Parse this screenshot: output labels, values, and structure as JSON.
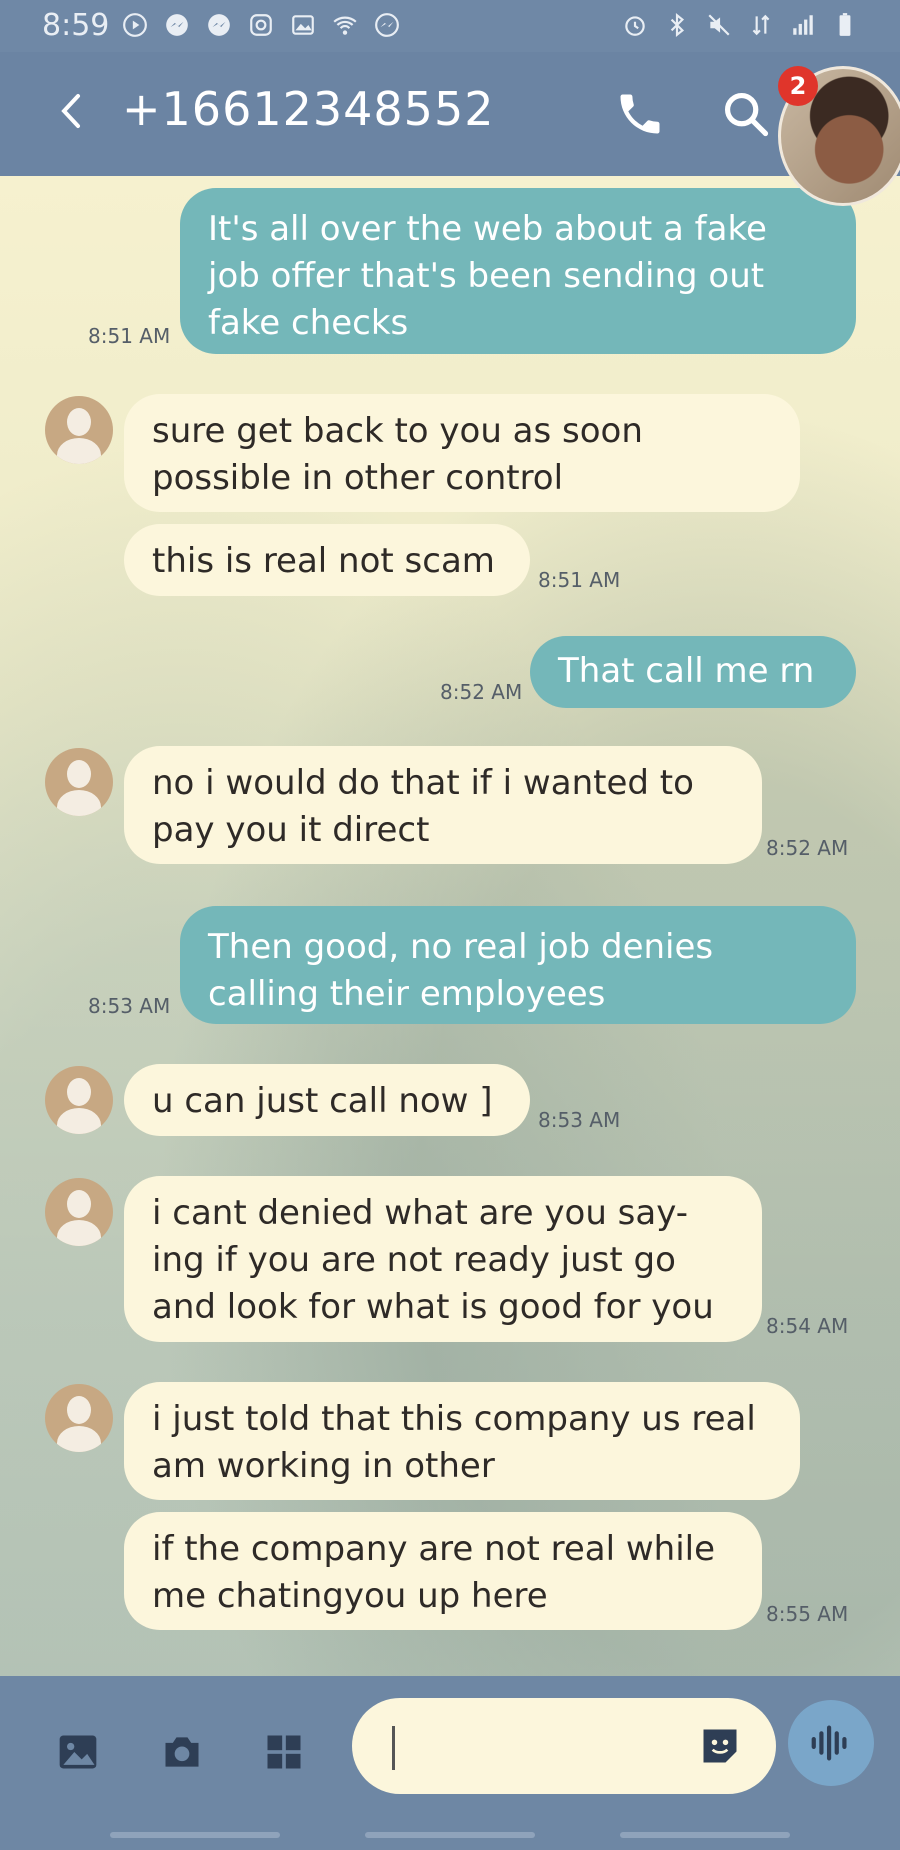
{
  "status_bar": {
    "time": "8:59"
  },
  "header": {
    "title": "+16612348552",
    "badge_count": "2"
  },
  "messages": [
    {
      "dir": "out",
      "text": "It's all over the web about a fake job offer that's been sending out fake checks",
      "time": "8:51 AM"
    },
    {
      "dir": "in",
      "text": "sure get back to you as soon possible in other control",
      "time": ""
    },
    {
      "dir": "in",
      "text": "this is real not scam",
      "time": "8:51 AM"
    },
    {
      "dir": "out",
      "text": "That call me rn",
      "time": "8:52 AM"
    },
    {
      "dir": "in",
      "text": "no i would do that if i wanted to pay you it direct",
      "time": "8:52 AM"
    },
    {
      "dir": "out",
      "text": "Then good,  no real job denies calling their employees",
      "time": "8:53 AM"
    },
    {
      "dir": "in",
      "text": "u can just call now ]",
      "time": "8:53 AM"
    },
    {
      "dir": "in",
      "text": "i cant denied what are you say-ing if you are not ready just go and look for what is good for you",
      "time": "8:54 AM"
    },
    {
      "dir": "in",
      "text": "i just told that this company us real am working in other",
      "time": ""
    },
    {
      "dir": "in",
      "text": "if the company are not real while me chatingyou up here",
      "time": "8:55 AM"
    }
  ],
  "composer": {
    "placeholder": ""
  },
  "colors": {
    "header": "#6b84a3",
    "outgoing": "#74b7b9",
    "incoming": "#fcf6dc"
  }
}
